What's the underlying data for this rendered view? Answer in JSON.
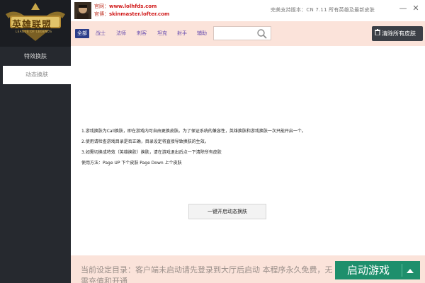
{
  "sidebar": {
    "logo_text": "英雄联盟",
    "logo_subtext": "LEAGUE OF LEGENDS",
    "items": [
      {
        "label": "特效换肤"
      },
      {
        "label": "动态换肤"
      }
    ]
  },
  "header": {
    "site_label_1": "官网：",
    "site_value_1": "www.lolhfds.com",
    "site_label_2": "官博：",
    "site_value_2": "skinmaster.lofter.com",
    "support": "完美支持版本：CN 7.11  所有英雄及最新皮肤",
    "minimize": "—",
    "close": "✕"
  },
  "toolbar": {
    "tabs": [
      {
        "label": "全部"
      },
      {
        "label": "战士"
      },
      {
        "label": "法师"
      },
      {
        "label": "刺客"
      },
      {
        "label": "坦克"
      },
      {
        "label": "射手"
      },
      {
        "label": "辅助"
      }
    ],
    "search_value": "",
    "clear_label": "清除所有皮肤"
  },
  "main": {
    "lines": [
      "1.游戏换肤为Call换肤，即在游戏内可自由更换皮肤。为了保证系统的兼容性，英雄换肤和游戏换肤一次只能开启一个。",
      "2.使用请检查游戏目录是否正确，目录设定将直接导致换肤的生效。",
      "3.如需切换成特效（英雄换肤）换肤，请在游戏退出后点一下清除所有皮肤",
      "使用方法：Page UP 下个皮肤  Page Down 上个皮肤"
    ],
    "start_button": "一键开启动态换肤"
  },
  "footer": {
    "text": "当前设定目录：客户端未启动请先登录到大厅后启动 本程序永久免费，无需充值和开通",
    "launch_label": "启动游戏"
  },
  "colors": {
    "sidebar_bg": "#26292f",
    "toolbar_bg": "#fbe3da",
    "launch_green": "#1e8f6c",
    "tab_active": "#2c3e8a",
    "link_red": "#d01818"
  }
}
